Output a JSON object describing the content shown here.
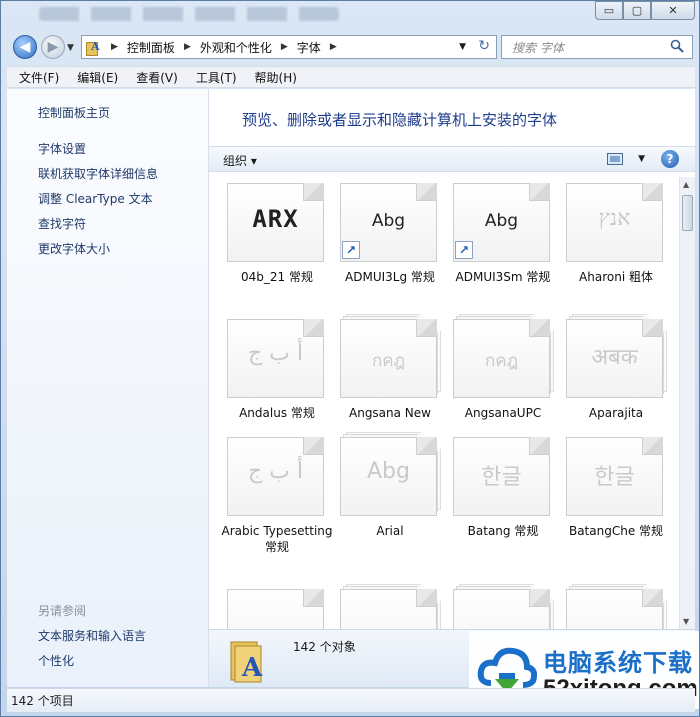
{
  "window": {
    "minimize": "▭",
    "maximize": "▢",
    "close": "✕"
  },
  "address": {
    "crumbs": [
      "控制面板",
      "外观和个性化",
      "字体"
    ]
  },
  "search": {
    "placeholder": "搜索 字体"
  },
  "menu": [
    "文件(F)",
    "编辑(E)",
    "查看(V)",
    "工具(T)",
    "帮助(H)"
  ],
  "sidebar": {
    "home": "控制面板主页",
    "links": [
      "字体设置",
      "联机获取字体详细信息",
      "调整 ClearType 文本",
      "查找字符",
      "更改字体大小"
    ],
    "see_also_heading": "另请参阅",
    "see_also": [
      "文本服务和输入语言",
      "个性化"
    ]
  },
  "main": {
    "title": "预览、删除或者显示和隐藏计算机上安装的字体",
    "organize": "组织 ▾"
  },
  "fonts": [
    {
      "name": "04b_21 常规",
      "preview": "ARX",
      "style": "mono",
      "faded": false,
      "stacked": false,
      "shortcut": false
    },
    {
      "name": "ADMUI3Lg 常规",
      "preview": "Abg",
      "style": "small",
      "faded": false,
      "stacked": false,
      "shortcut": true
    },
    {
      "name": "ADMUI3Sm 常规",
      "preview": "Abg",
      "style": "small",
      "faded": false,
      "stacked": false,
      "shortcut": true
    },
    {
      "name": "Aharoni 粗体",
      "preview": "אנץ",
      "style": "serif",
      "faded": true,
      "stacked": false,
      "shortcut": false
    },
    {
      "name": "Andalus 常规",
      "preview": "أ ب ج",
      "style": "serif",
      "faded": true,
      "stacked": false,
      "shortcut": false
    },
    {
      "name": "Angsana New",
      "preview": "กคฎ",
      "style": "small",
      "faded": true,
      "stacked": true,
      "shortcut": false
    },
    {
      "name": "AngsanaUPC",
      "preview": "กคฎ",
      "style": "small",
      "faded": true,
      "stacked": true,
      "shortcut": false
    },
    {
      "name": "Aparajita",
      "preview": "अबक",
      "style": "serif",
      "faded": true,
      "stacked": true,
      "shortcut": false
    },
    {
      "name": "Arabic Typesetting 常规",
      "preview": "أ ب ج",
      "style": "serif",
      "faded": true,
      "stacked": false,
      "shortcut": false
    },
    {
      "name": "Arial",
      "preview": "Abg",
      "style": "plain",
      "faded": true,
      "stacked": true,
      "shortcut": false
    },
    {
      "name": "Batang 常规",
      "preview": "한글",
      "style": "plain",
      "faded": true,
      "stacked": false,
      "shortcut": false
    },
    {
      "name": "BatangChe 常规",
      "preview": "한글",
      "style": "plain",
      "faded": true,
      "stacked": false,
      "shortcut": false
    },
    {
      "name": "",
      "preview": "",
      "style": "plain",
      "faded": true,
      "stacked": false,
      "shortcut": false
    },
    {
      "name": "",
      "preview": "",
      "style": "plain",
      "faded": true,
      "stacked": true,
      "shortcut": false
    },
    {
      "name": "",
      "preview": "",
      "style": "plain",
      "faded": true,
      "stacked": true,
      "shortcut": false
    },
    {
      "name": "",
      "preview": "",
      "style": "plain",
      "faded": true,
      "stacked": true,
      "shortcut": false
    }
  ],
  "details": {
    "count": "142 个对象"
  },
  "status": {
    "items": "142 个项目"
  },
  "watermark": {
    "line1": "电脑系统下载",
    "line2": "52xitong.com"
  }
}
